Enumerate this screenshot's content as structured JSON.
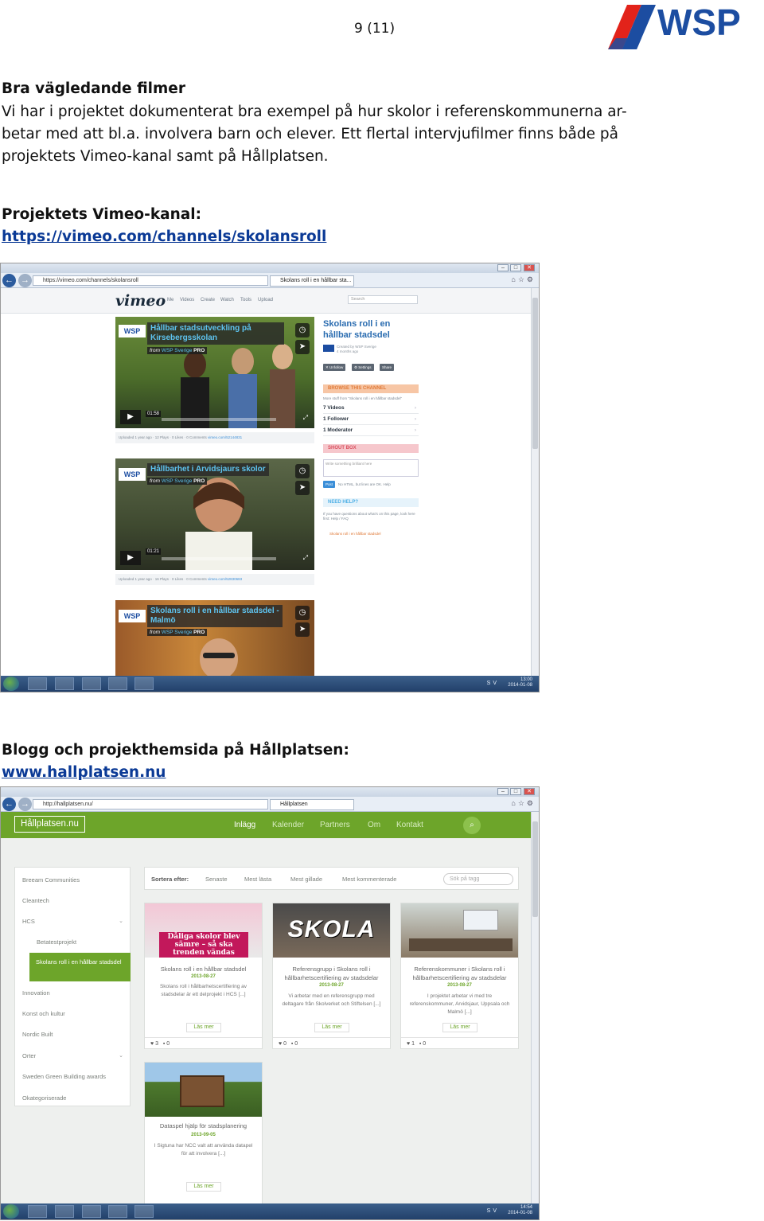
{
  "header": {
    "page_number": "9 (11)",
    "logo_text": "WSP"
  },
  "section1": {
    "heading": "Bra vägledande filmer",
    "lines": [
      "Vi har i projektet dokumenterat bra exempel på hur skolor i referenskommunerna ar-",
      "betar med att bl.a. involvera barn och elever. Ett flertal intervjufilmer finns både på",
      "projektets Vimeo-kanal samt på Hållplatsen."
    ],
    "link_label": "Projektets Vimeo-kanal:",
    "link_url": "https://vimeo.com/channels/skolansroll"
  },
  "vimeo_shot": {
    "url": "https://vimeo.com/channels/skolansroll",
    "tab": "Skolans roll i en hållbar sta...",
    "logo": "vimeo",
    "menu": [
      "Me",
      "Videos",
      "Create",
      "Watch",
      "Tools",
      "Upload"
    ],
    "search_placeholder": "Search",
    "videos": [
      {
        "title": "Hållbar stadsutveckling på Kirsebergsskolan",
        "from": "from",
        "author": "WSP Sverige",
        "badge": "PRO",
        "time": "01:58",
        "meta": "Uploaded 1 year ago · 12 Plays · 0 Likes · 0 Comments",
        "vurl": "vimeo.com/52144831"
      },
      {
        "title": "Hållbarhet i Arvidsjaurs skolor",
        "from": "from",
        "author": "WSP Sverige",
        "badge": "PRO",
        "time": "01:21",
        "meta": "Uploaded 1 year ago · 16 Plays · 0 Likes · 0 Comments",
        "vurl": "vimeo.com/52830683"
      },
      {
        "title": "Skolans roll i en hållbar stadsdel - Malmö",
        "from": "from",
        "author": "WSP Sverige",
        "badge": "PRO"
      }
    ],
    "channel": {
      "title": "Skolans roll i en hållbar stadsdel",
      "created_by": "Created by WSP Sverige",
      "created_ago": "4 months ago",
      "buttons": [
        "✕ Unfollow",
        "⚙ Settings",
        "Share"
      ],
      "browse_head": "BROWSE THIS CHANNEL",
      "browse_sub": "More stuff from \"Skolans roll i en hållbar stadsdel\"",
      "rows": [
        "7 Videos",
        "1 Follower",
        "1 Moderator"
      ],
      "shout_head": "SHOUT BOX",
      "shout_placeholder": "Write something brilliant here",
      "post_label": "Post",
      "post_hint": "No HTML, but lines are OK. Help",
      "help_head": "NEED HELP?",
      "help_text": "If you have questions about what's on this page, look here first: Help / FAQ",
      "rss": "Skolans roll i en hållbar stadsdel"
    },
    "taskbar": {
      "lang": "SV",
      "time": "13:00",
      "date": "2014-01-08"
    }
  },
  "section2": {
    "heading": "Blogg och projekthemsida på Hållplatsen:",
    "link_url": "www.hallplatsen.nu"
  },
  "hp_shot": {
    "url": "http://hallplatsen.nu/",
    "tab": "Hållplatsen",
    "logo": "Hållplatsen.nu",
    "menu": [
      "Inlägg",
      "Kalender",
      "Partners",
      "Om",
      "Kontakt"
    ],
    "sidebar": {
      "items": [
        "Breeam Communities",
        "Cleantech",
        "HCS",
        "Innovation",
        "Konst och kultur",
        "Nordic Built",
        "Orter",
        "Sweden Green Building awards",
        "Okategoriserade"
      ],
      "sub_items": [
        "Betatestprojekt"
      ],
      "active": "Skolans roll i en hållbar stadsdel"
    },
    "sort": {
      "label": "Sortera efter:",
      "options": [
        "Senaste",
        "Mest lästa",
        "Mest gillade",
        "Mest kommenterade"
      ],
      "search_placeholder": "Sök på tagg"
    },
    "cards": [
      {
        "img_text": "Dåliga skolor blev sämre – så ska trenden vändas",
        "title": "Skolans roll i en hållbar stadsdel",
        "date": "2013-08-27",
        "desc": "Skolans roll i hållbarhetscertifiering av stadsdelar är ett delprojekt i HCS [...]",
        "more": "Läs mer",
        "likes": "3",
        "comments": "0"
      },
      {
        "img_text": "SKOLA",
        "title": "Referensgrupp i Skolans roll i hållbarhetscertifiering av stadsdelar",
        "date": "2013-08-27",
        "desc": "Vi arbetar med en referensgrupp med deltagare från Skolverket och Stiftelsen [...]",
        "more": "Läs mer",
        "likes": "0",
        "comments": "0"
      },
      {
        "img_text": "",
        "title": "Referenskommuner i Skolans roll i hållbarhetscertifiering av stadsdelar",
        "date": "2013-08-27",
        "desc": "I projektet arbetar vi med tre referenskommuner, Arvidsjaur, Uppsala och Malmö [...]",
        "more": "Läs mer",
        "likes": "1",
        "comments": "0"
      },
      {
        "img_text": "",
        "title": "Dataspel hjälp för stadsplanering",
        "date": "2013-09-05",
        "desc": "I Sigtuna har NCC valt att använda datapel för att involvera [...]",
        "more": "Läs mer"
      }
    ],
    "taskbar": {
      "lang": "SV",
      "time": "14:54",
      "date": "2014-01-08"
    }
  },
  "colors": {
    "wsp_blue": "#1c4da1",
    "wsp_red": "#e2231a",
    "hp_green": "#6da52a",
    "vimeo_blue": "#2a6cb0",
    "link": "#0b3a96"
  }
}
